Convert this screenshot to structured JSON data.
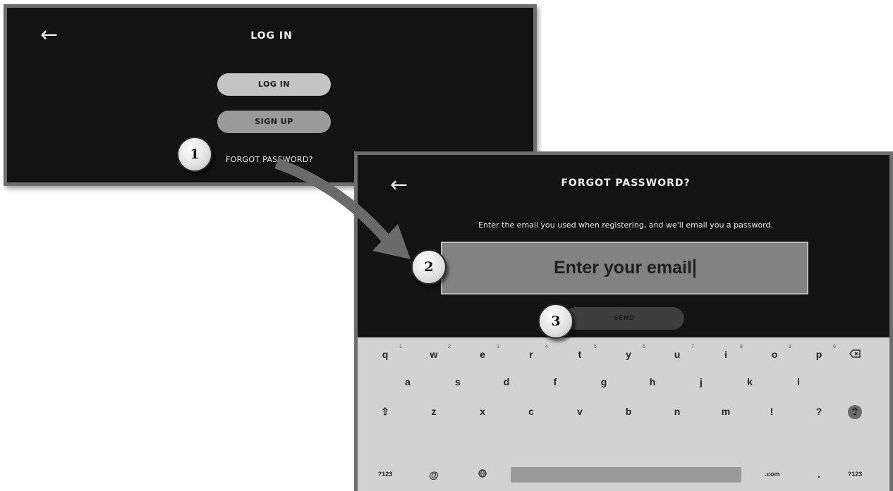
{
  "login_screen": {
    "back_icon": "arrow-left-icon",
    "title": "LOG IN",
    "login_button": "LOG IN",
    "signup_button": "SIGN UP",
    "forgot_link": "FORGOT PASSWORD?"
  },
  "forgot_screen": {
    "back_icon": "arrow-left-icon",
    "title": "FORGOT PASSWORD?",
    "description": "Enter the email you used when registering, and we'll email you a password.",
    "email_placeholder": "Enter your email",
    "send_button": "SEND"
  },
  "keyboard": {
    "row1": [
      {
        "key": "q",
        "hint": "1"
      },
      {
        "key": "w",
        "hint": "2"
      },
      {
        "key": "e",
        "hint": "3"
      },
      {
        "key": "r",
        "hint": "4"
      },
      {
        "key": "t",
        "hint": "5"
      },
      {
        "key": "y",
        "hint": "6"
      },
      {
        "key": "u",
        "hint": "7"
      },
      {
        "key": "i",
        "hint": "8"
      },
      {
        "key": "o",
        "hint": "9"
      },
      {
        "key": "p",
        "hint": "0"
      }
    ],
    "row2": [
      "a",
      "s",
      "d",
      "f",
      "g",
      "h",
      "j",
      "k",
      "l"
    ],
    "row3": [
      "z",
      "x",
      "c",
      "v",
      "b",
      "n",
      "m",
      "!",
      "?"
    ],
    "row4": {
      "sym_left": "?123",
      "at": "@",
      "dotcom": ".com",
      "period": ".",
      "sym_right": "?123"
    },
    "icons": {
      "backspace": "backspace-icon",
      "done": "check-icon",
      "shift": "shift-icon",
      "globe": "globe-icon"
    }
  },
  "badges": [
    "1",
    "2",
    "3"
  ],
  "colors": {
    "screen_bg": "#131313",
    "keyboard_bg": "#d2d2d2",
    "badge": "#e2e2e2",
    "arrow": "#6a6a6a"
  }
}
